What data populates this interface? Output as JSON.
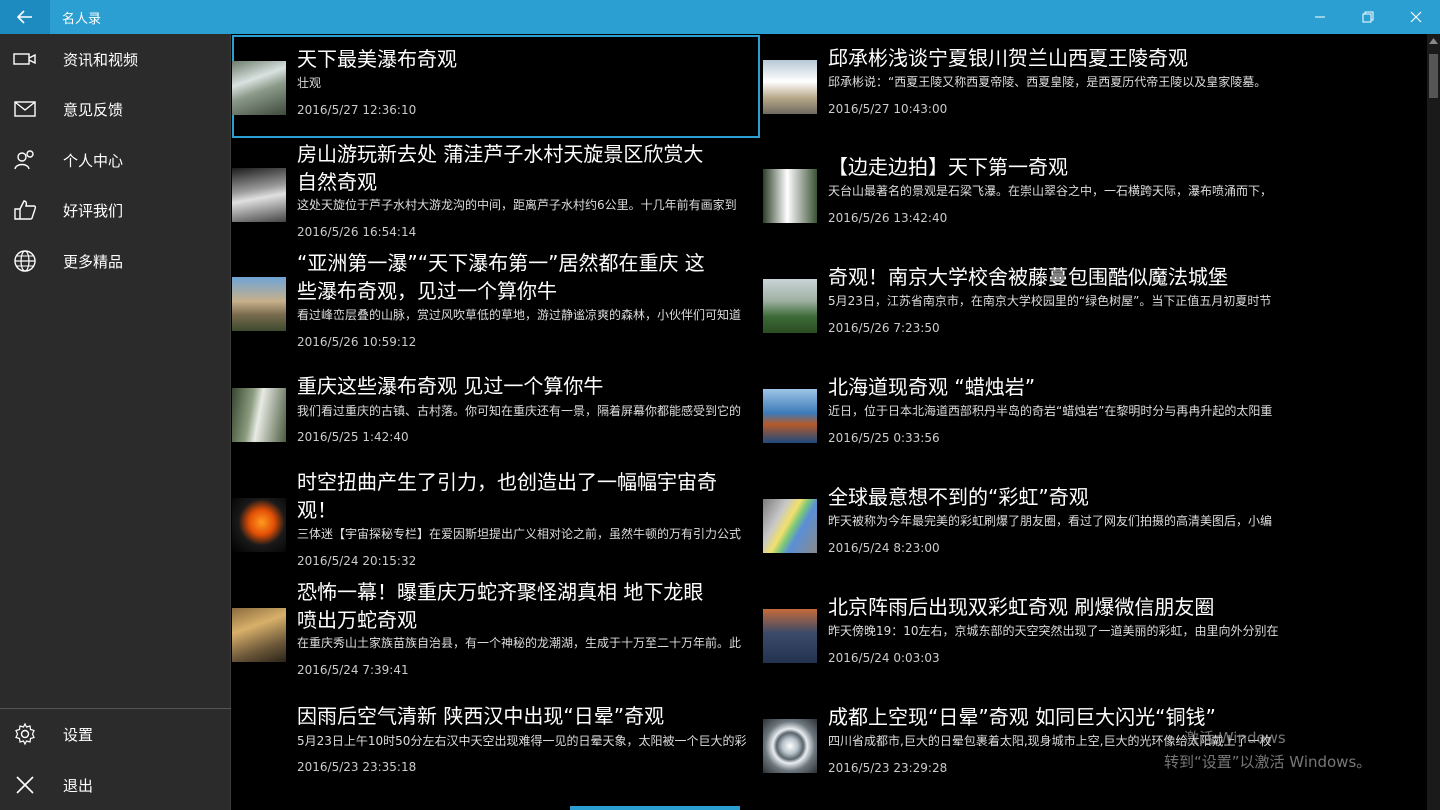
{
  "titlebar": {
    "title": "名人录"
  },
  "sidebar": {
    "items": [
      {
        "label": "资讯和视频",
        "icon": "video-icon"
      },
      {
        "label": "意见反馈",
        "icon": "mail-icon"
      },
      {
        "label": "个人中心",
        "icon": "people-icon"
      },
      {
        "label": "好评我们",
        "icon": "thumbs-up-icon"
      },
      {
        "label": "更多精品",
        "icon": "globe-icon"
      }
    ],
    "bottom": [
      {
        "label": "设置",
        "icon": "gear-icon"
      },
      {
        "label": "退出",
        "icon": "close-icon"
      }
    ]
  },
  "articles_left": [
    {
      "title": "天下最美瀑布奇观",
      "desc": "壮观",
      "time": "2016/5/27 12:36:10",
      "thumb": "t-waterfall1"
    },
    {
      "title": "房山游玩新去处 蒲洼芦子水村天旋景区欣赏大自然奇观",
      "desc": "这处天旋位于芦子水村大游龙沟的中间，距离芦子水村约6公里。十几年前有画家到",
      "time": "2016/5/26 16:54:14",
      "thumb": "t-cave"
    },
    {
      "title": "“亚洲第一瀑”“天下瀑布第一”居然都在重庆 这些瀑布奇观，见过一个算你牛",
      "desc": "看过峰峦层叠的山脉，赏过风吹草低的草地，游过静谧凉爽的森林，小伙伴们可知道",
      "time": "2016/5/26 10:59:12",
      "thumb": "t-asia"
    },
    {
      "title": "重庆这些瀑布奇观 见过一个算你牛",
      "desc": "我们看过重庆的古镇、古村落。你可知在重庆还有一景，隔着屏幕你都能感受到它的",
      "time": "2016/5/25 1:42:40",
      "thumb": "t-chongqing"
    },
    {
      "title": "时空扭曲产生了引力，也创造出了一幅幅宇宙奇观！",
      "desc": "三体迷【宇宙探秘专栏】在爱因斯坦提出广义相对论之前，虽然牛顿的万有引力公式",
      "time": "2016/5/24 20:15:32",
      "thumb": "t-space"
    },
    {
      "title": "恐怖一幕！曝重庆万蛇齐聚怪湖真相 地下龙眼喷出万蛇奇观",
      "desc": "在重庆秀山土家族苗族自治县，有一个神秘的龙潮湖，生成于十万至二十万年前。此",
      "time": "2016/5/24 7:39:41",
      "thumb": "t-snake"
    },
    {
      "title": "因雨后空气清新 陕西汉中出现“日晕”奇观",
      "desc": "5月23日上午10时50分左右汉中天空出现难得一见的日晕天象，太阳被一个巨大的彩",
      "time": "2016/5/23 23:35:18",
      "thumb": ""
    }
  ],
  "articles_right": [
    {
      "title": "邱承彬浅谈宁夏银川贺兰山西夏王陵奇观",
      "desc": "邱承彬说：“西夏王陵又称西夏帝陵、西夏皇陵，是西夏历代帝王陵以及皇家陵墓。",
      "time": "2016/5/27 10:43:00",
      "thumb": "t-xixia"
    },
    {
      "title": "【边走边拍】天下第一奇观",
      "desc": "天台山最著名的景观是石梁飞瀑。在崇山翠谷之中，一石横跨天际，瀑布喷涌而下，",
      "time": "2016/5/26 13:42:40",
      "thumb": "t-waterfall2"
    },
    {
      "title": "奇观！南京大学校舍被藤蔓包围酷似魔法城堡",
      "desc": "5月23日，江苏省南京市，在南京大学校园里的“绿色树屋”。当下正值五月初夏时节",
      "time": "2016/5/26 7:23:50",
      "thumb": "t-nanjing"
    },
    {
      "title": "北海道现奇观 “蜡烛岩”",
      "desc": "近日，位于日本北海道西部积丹半岛的奇岩“蜡烛岩”在黎明时分与再冉升起的太阳重",
      "time": "2016/5/25 0:33:56",
      "thumb": "t-hokkaido"
    },
    {
      "title": "全球最意想不到的“彩虹”奇观",
      "desc": "昨天被称为今年最完美的彩虹刷爆了朋友圈，看过了网友们拍摄的高清美图后，小编",
      "time": "2016/5/24 8:23:00",
      "thumb": "t-rainbow"
    },
    {
      "title": "北京阵雨后出现双彩虹奇观 刷爆微信朋友圈",
      "desc": "昨天傍晚19：10左右，京城东部的天空突然出现了一道美丽的彩虹，由里向外分别在",
      "time": "2016/5/24 0:03:03",
      "thumb": "t-doublerainbow"
    },
    {
      "title": "成都上空现“日晕”奇观 如同巨大闪光“铜钱”",
      "desc": "四川省成都市,巨大的日晕包裹着太阳,现身城市上空,巨大的光环像给太阳戴上了一枚",
      "time": "2016/5/23 23:29:28",
      "thumb": "t-halo"
    }
  ],
  "watermark": {
    "line1": "激活 Windows",
    "line2": "转到“设置”以激活 Windows。"
  }
}
